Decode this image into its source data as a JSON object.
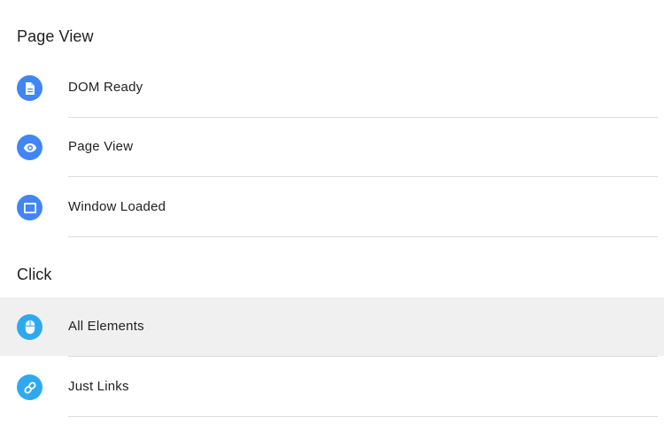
{
  "sections": [
    {
      "title": "Page View",
      "items": [
        {
          "label": "DOM Ready",
          "icon": "document-icon",
          "icon_color": "#4285f4",
          "selected": false
        },
        {
          "label": "Page View",
          "icon": "eye-icon",
          "icon_color": "#4285f4",
          "selected": false
        },
        {
          "label": "Window Loaded",
          "icon": "window-icon",
          "icon_color": "#4285f4",
          "selected": false
        }
      ]
    },
    {
      "title": "Click",
      "items": [
        {
          "label": "All Elements",
          "icon": "mouse-icon",
          "icon_color": "#2ea9f0",
          "selected": true
        },
        {
          "label": "Just Links",
          "icon": "link-icon",
          "icon_color": "#2ea9f0",
          "selected": false
        }
      ]
    }
  ]
}
